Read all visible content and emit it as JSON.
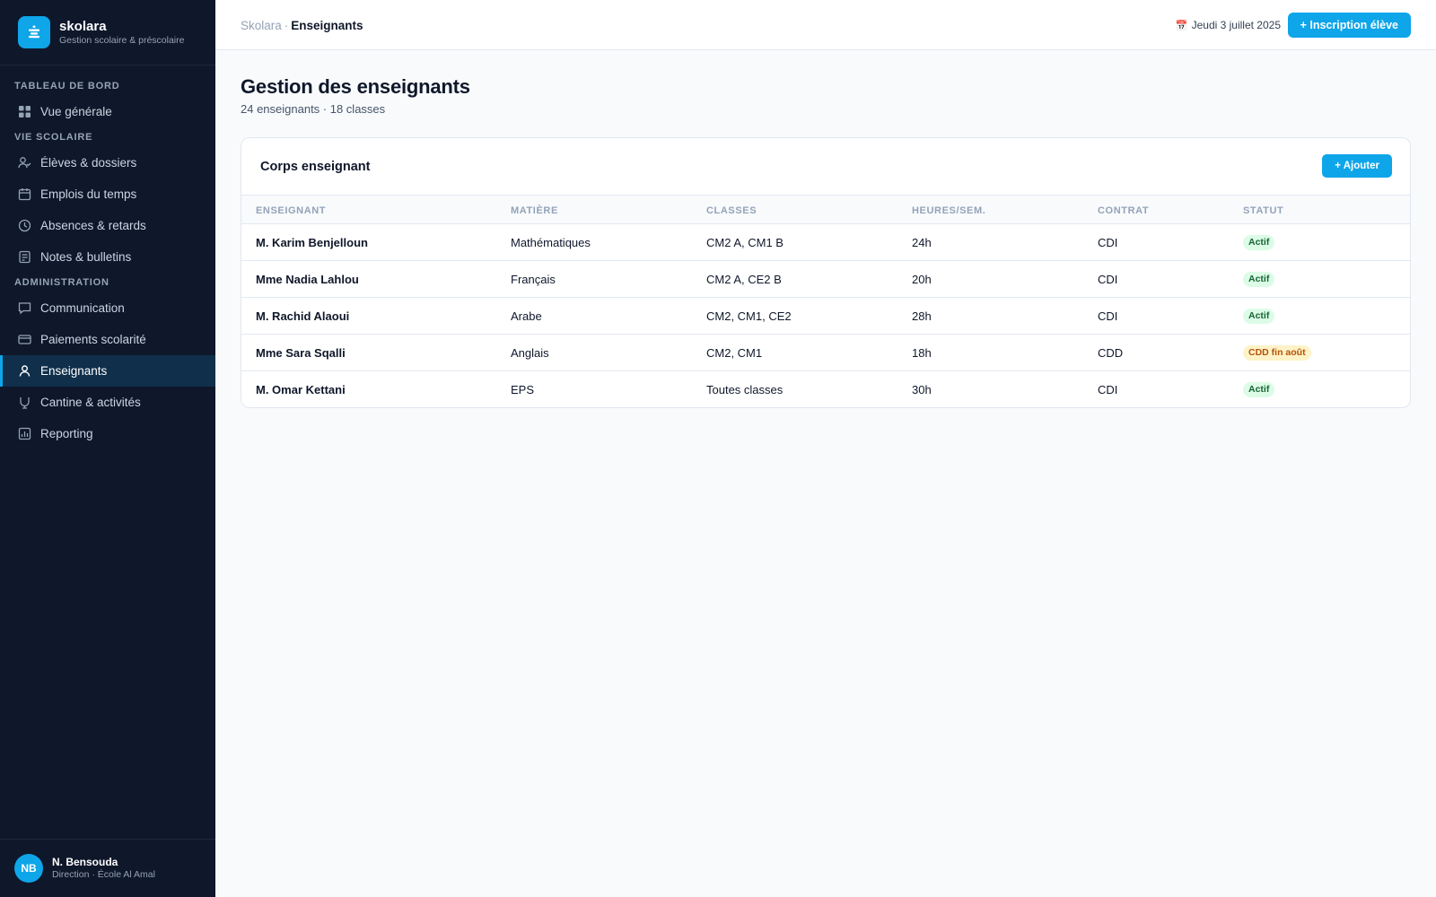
{
  "brand": {
    "name": "skolara",
    "subtitle": "Gestion scolaire & préscolaire"
  },
  "sidebar": {
    "sections": [
      {
        "label": "TABLEAU DE BORD"
      },
      {
        "label": "VIE SCOLAIRE"
      },
      {
        "label": "ADMINISTRATION"
      }
    ],
    "items": [
      {
        "label": "Vue générale",
        "icon": "grid-icon"
      },
      {
        "label": "Élèves & dossiers",
        "icon": "user-check-icon"
      },
      {
        "label": "Emplois du temps",
        "icon": "calendar-icon"
      },
      {
        "label": "Absences & retards",
        "icon": "clock-icon"
      },
      {
        "label": "Notes & bulletins",
        "icon": "document-icon"
      },
      {
        "label": "Communication",
        "icon": "chat-icon"
      },
      {
        "label": "Paiements scolarité",
        "icon": "credit-card-icon"
      },
      {
        "label": "Enseignants",
        "icon": "user-icon",
        "active": true
      },
      {
        "label": "Cantine & activités",
        "icon": "cup-icon"
      },
      {
        "label": "Reporting",
        "icon": "chart-icon"
      }
    ]
  },
  "user": {
    "initials": "NB",
    "name": "N. Bensouda",
    "role": "Direction · École Al Amal"
  },
  "header": {
    "breadcrumb_root": "Skolara",
    "breadcrumb_sep": "·",
    "breadcrumb_current": "Enseignants",
    "date": "Jeudi 3 juillet 2025",
    "date_icon": "calendar-emoji-icon",
    "primary_button": "+ Inscription élève"
  },
  "page": {
    "title": "Gestion des enseignants",
    "subtitle": "24 enseignants · 18 classes"
  },
  "card": {
    "title": "Corps enseignant",
    "add_button": "+ Ajouter",
    "columns": [
      "Enseignant",
      "Matière",
      "Classes",
      "Heures/sem.",
      "Contrat",
      "Statut"
    ],
    "rows": [
      {
        "name": "M. Karim Benjelloun",
        "subject": "Mathématiques",
        "classes": "CM2 A, CM1 B",
        "hours": "24h",
        "contract": "CDI",
        "status": "Actif",
        "status_type": "ok"
      },
      {
        "name": "Mme Nadia Lahlou",
        "subject": "Français",
        "classes": "CM2 A, CE2 B",
        "hours": "20h",
        "contract": "CDI",
        "status": "Actif",
        "status_type": "ok"
      },
      {
        "name": "M. Rachid Alaoui",
        "subject": "Arabe",
        "classes": "CM2, CM1, CE2",
        "hours": "28h",
        "contract": "CDI",
        "status": "Actif",
        "status_type": "ok"
      },
      {
        "name": "Mme Sara Sqalli",
        "subject": "Anglais",
        "classes": "CM2, CM1",
        "hours": "18h",
        "contract": "CDD",
        "status": "CDD fin août",
        "status_type": "warn"
      },
      {
        "name": "M. Omar Kettani",
        "subject": "EPS",
        "classes": "Toutes classes",
        "hours": "30h",
        "contract": "CDI",
        "status": "Actif",
        "status_type": "ok"
      }
    ]
  },
  "colors": {
    "accent": "#0ea5e9",
    "sidebar_bg": "#0f172a",
    "active_bg": "#0f2f4a",
    "ok_bg": "#dcfce7",
    "ok_fg": "#166534",
    "warn_bg": "#fef3c7",
    "warn_fg": "#b45309"
  }
}
